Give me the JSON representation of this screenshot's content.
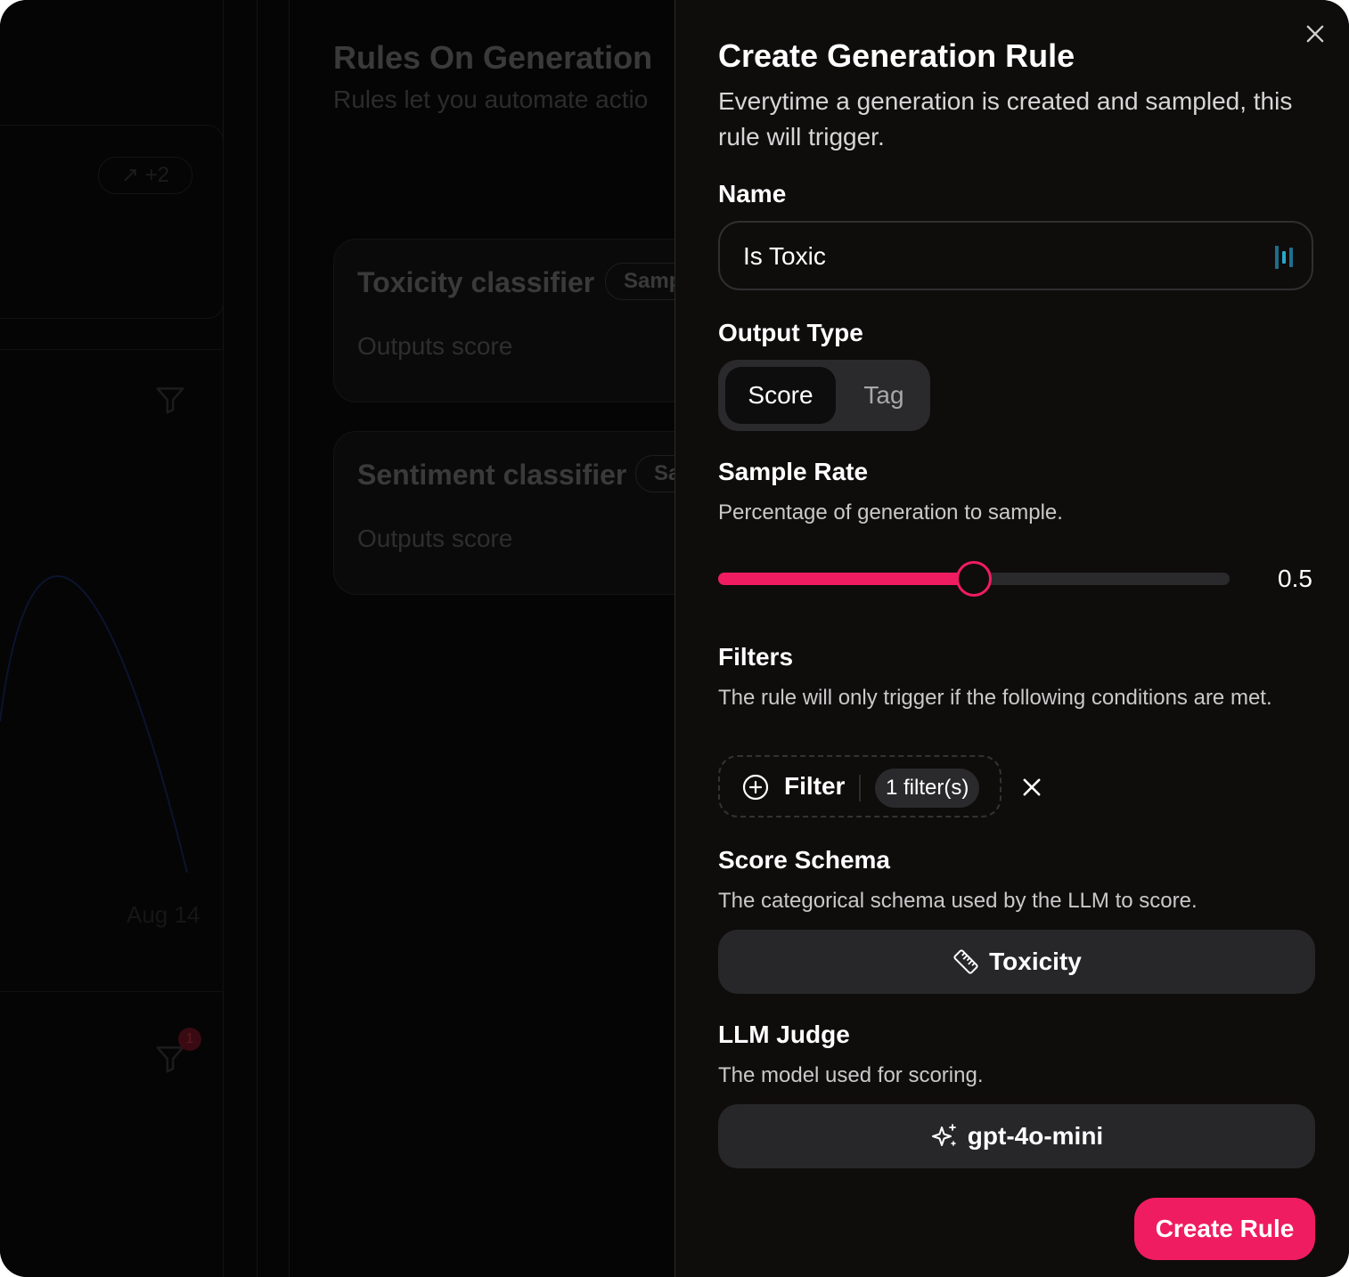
{
  "background": {
    "page_title": "Rules On Generation",
    "page_subtitle": "Rules let you automate actio",
    "chip_label": "↗ +2",
    "axis_label": "Aug 14",
    "badge_count": "1",
    "cards": [
      {
        "title": "Toxicity classifier",
        "pill": "Samp",
        "subtitle": "Outputs score"
      },
      {
        "title": "Sentiment classifier",
        "pill": "Sa",
        "subtitle": "Outputs score"
      }
    ]
  },
  "modal": {
    "title": "Create Generation Rule",
    "description": "Everytime a generation is created and sampled, this rule will trigger.",
    "name": {
      "label": "Name",
      "value": "Is Toxic"
    },
    "output_type": {
      "label": "Output Type",
      "options": [
        "Score",
        "Tag"
      ],
      "selected": "Score"
    },
    "sample_rate": {
      "label": "Sample Rate",
      "description": "Percentage of generation to sample.",
      "value": 0.5,
      "value_text": "0.5"
    },
    "filters": {
      "label": "Filters",
      "description": "The rule will only trigger if the following conditions are met.",
      "button_label": "Filter",
      "count_label": "1 filter(s)"
    },
    "score_schema": {
      "label": "Score Schema",
      "description": "The categorical schema used by the LLM to score.",
      "value": "Toxicity",
      "icon": "ruler-icon"
    },
    "llm_judge": {
      "label": "LLM Judge",
      "description": "The model used for scoring.",
      "value": "gpt-4o-mini",
      "icon": "sparkles-icon"
    },
    "submit_label": "Create Rule"
  },
  "colors": {
    "accent": "#f01c62",
    "surface": "#0f0c0c",
    "control": "#272729"
  }
}
